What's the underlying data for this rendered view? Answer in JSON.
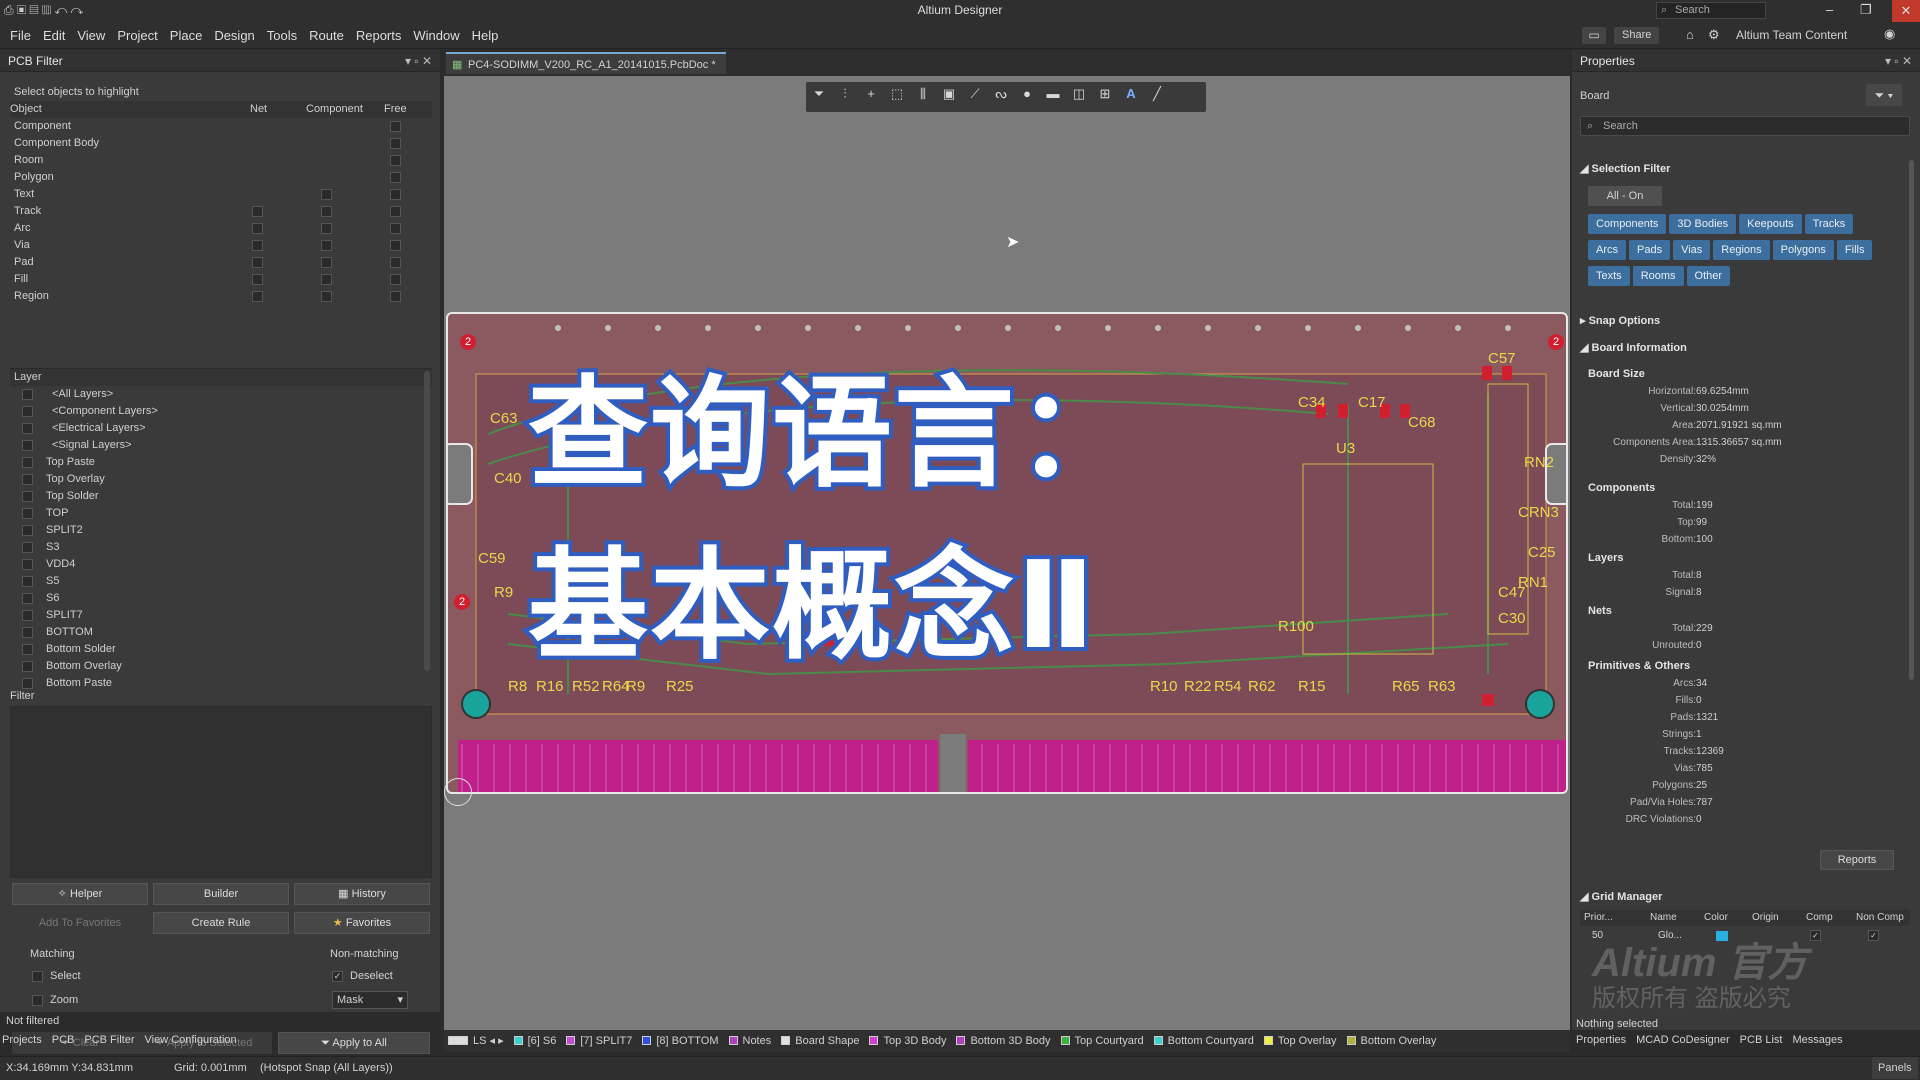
{
  "app": {
    "title": "Altium Designer",
    "search_placeholder": "Search",
    "share": "Share",
    "team_content": "Altium Team Content"
  },
  "menu": [
    "File",
    "Edit",
    "View",
    "Project",
    "Place",
    "Design",
    "Tools",
    "Route",
    "Reports",
    "Window",
    "Help"
  ],
  "pcb_filter": {
    "title": "PCB Filter",
    "hint": "Select objects to highlight",
    "headers": [
      "Object",
      "Net",
      "Component",
      "Free"
    ],
    "objects": [
      "Component",
      "Component Body",
      "Room",
      "Polygon",
      "Text",
      "Track",
      "Arc",
      "Via",
      "Pad",
      "Fill",
      "Region"
    ],
    "layer_header": "Layer",
    "layers": [
      "<All Layers>",
      "<Component Layers>",
      "<Electrical Layers>",
      "<Signal Layers>",
      "Top Paste",
      "Top Overlay",
      "Top Solder",
      "TOP",
      "SPLIT2",
      "S3",
      "VDD4",
      "S5",
      "S6",
      "SPLIT7",
      "BOTTOM",
      "Bottom Solder",
      "Bottom Overlay",
      "Bottom Paste"
    ],
    "filter_label": "Filter",
    "buttons": {
      "helper": "Helper",
      "builder": "Builder",
      "history": "History",
      "add_fav": "Add To Favorites",
      "create_rule": "Create Rule",
      "favorites": "Favorites",
      "clear": "Clear",
      "apply_selected": "Apply to Selected",
      "apply_all": "Apply to All"
    },
    "matching": "Matching",
    "non_matching": "Non-matching",
    "select": "Select",
    "zoom": "Zoom",
    "deselect": "Deselect",
    "mask": "Mask"
  },
  "doc_tab": "PC4-SODIMM_V200_RC_A1_20141015.PcbDoc *",
  "overlay": {
    "line1": "查询语言：",
    "line2": "基本概念Ⅱ"
  },
  "board_labels": [
    "C63",
    "C40",
    "C59",
    "R9",
    "R8",
    "R16",
    "R52",
    "R64",
    "R9",
    "R25",
    "C34",
    "C17",
    "C68",
    "U3",
    "C57",
    "C25",
    "R100",
    "C30",
    "C47",
    "RN1",
    "CRN3",
    "RN2",
    "R10",
    "R22",
    "R54",
    "R62",
    "R15",
    "R65",
    "R63",
    "2",
    "2",
    "2"
  ],
  "properties": {
    "title": "Properties",
    "scope": "Board",
    "search": "Search",
    "selection_filter": "Selection Filter",
    "all_on": "All - On",
    "filters": [
      "Components",
      "3D Bodies",
      "Keepouts",
      "Tracks",
      "Arcs",
      "Pads",
      "Vias",
      "Regions",
      "Polygons",
      "Fills",
      "Texts",
      "Rooms",
      "Other"
    ],
    "snap": "Snap Options",
    "board_info": "Board Information",
    "board_size": "Board Size",
    "size": [
      {
        "k": "Horizontal:",
        "v": "69.6254mm"
      },
      {
        "k": "Vertical:",
        "v": "30.0254mm"
      },
      {
        "k": "Area:",
        "v": "2071.91921 sq.mm"
      },
      {
        "k": "Components Area:",
        "v": "1315.36657 sq.mm"
      },
      {
        "k": "Density:",
        "v": "32%"
      }
    ],
    "components_label": "Components",
    "components": [
      {
        "k": "Total:",
        "v": "199"
      },
      {
        "k": "Top:",
        "v": "99"
      },
      {
        "k": "Bottom:",
        "v": "100"
      }
    ],
    "layers_label": "Layers",
    "layers": [
      {
        "k": "Total:",
        "v": "8"
      },
      {
        "k": "Signal:",
        "v": "8"
      }
    ],
    "nets_label": "Nets",
    "nets": [
      {
        "k": "Total:",
        "v": "229"
      },
      {
        "k": "Unrouted:",
        "v": "0"
      }
    ],
    "prims_label": "Primitives & Others",
    "prims": [
      {
        "k": "Arcs:",
        "v": "34"
      },
      {
        "k": "Fills:",
        "v": "0"
      },
      {
        "k": "Pads:",
        "v": "1321"
      },
      {
        "k": "Strings:",
        "v": "1"
      },
      {
        "k": "Tracks:",
        "v": "12369"
      },
      {
        "k": "Vias:",
        "v": "785"
      },
      {
        "k": "Polygons:",
        "v": "25"
      },
      {
        "k": "Pad/Via Holes:",
        "v": "787"
      },
      {
        "k": "DRC Violations:",
        "v": "0"
      }
    ],
    "reports": "Reports",
    "grid_manager": "Grid Manager",
    "grid_headers": [
      "Prior...",
      "Name",
      "Color",
      "Origin",
      "Comp",
      "Non Comp"
    ],
    "grid_row": {
      "prio": "50",
      "name": "Glo..."
    },
    "nothing_selected": "Nothing selected",
    "watermark1": "Altium 官方",
    "watermark2": "版权所有 盗版必究"
  },
  "layer_tabs": [
    "LS",
    "[6] S6",
    "[7] SPLIT7",
    "[8] BOTTOM",
    "Notes",
    "Board Shape",
    "Top 3D Body",
    "Bottom 3D Body",
    "Top Courtyard",
    "Bottom Courtyard",
    "Top Overlay",
    "Bottom Overlay"
  ],
  "layer_colors": [
    "#3ad0d0",
    "#c050d0",
    "#3050e0",
    "#b040c0",
    "#e0e0e0",
    "#d040d0",
    "#b040c0",
    "#40b040",
    "#40d0d0",
    "#f0f040",
    "#b0b040"
  ],
  "bottom_tabs_left": [
    "Projects",
    "PCB",
    "PCB Filter",
    "View Configuration"
  ],
  "bottom_tabs_right": [
    "Properties",
    "MCAD CoDesigner",
    "PCB List",
    "Messages"
  ],
  "not_filtered": "Not filtered",
  "status": {
    "coords": "X:34.169mm Y:34.831mm",
    "grid": "Grid: 0.001mm",
    "snap": "(Hotspot Snap (All Layers))",
    "panels": "Panels"
  }
}
